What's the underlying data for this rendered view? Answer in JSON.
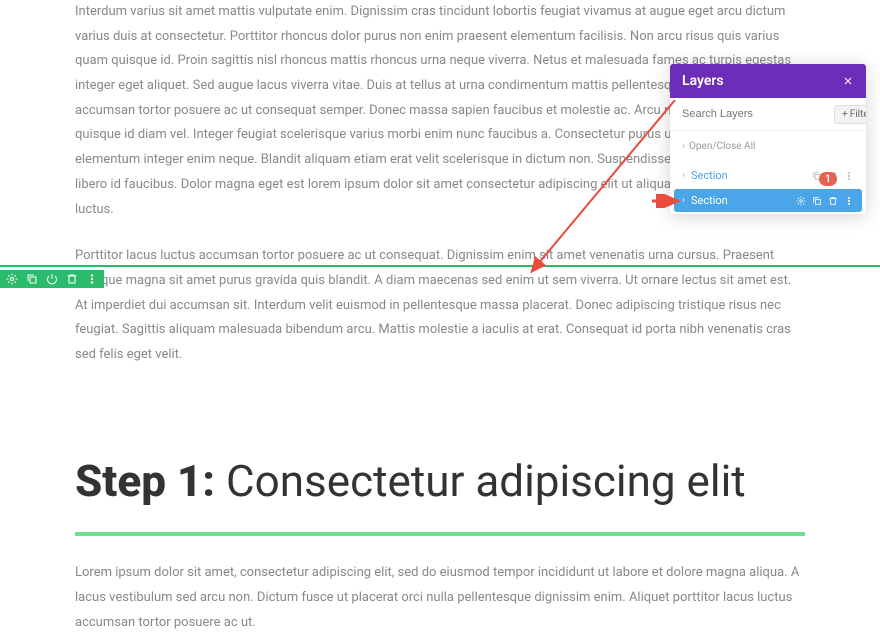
{
  "content": {
    "p1": "Interdum varius sit amet mattis vulputate enim. Dignissim cras tincidunt lobortis feugiat vivamus at augue eget arcu dictum varius duis at consectetur. Porttitor rhoncus dolor purus non enim praesent elementum facilisis. Non arcu risus quis varius quam quisque id. Proin sagittis nisl rhoncus mattis rhoncus urna neque viverra. Netus et malesuada fames ac turpis egestas integer eget aliquet. Sed augue lacus viverra vitae. Duis at tellus at urna condimentum mattis pellentesque id. Luctus accumsan tortor posuere ac ut consequat semper. Donec massa sapien faucibus et molestie ac. Arcu risus quis varius quam quisque id diam vel. Integer feugiat scelerisque varius morbi enim nunc faucibus a. Consectetur purus ut faucibus pulvinar elementum integer enim neque. Blandit aliquam etiam erat velit scelerisque in dictum non. Suspendisse interdum consectetur libero id faucibus. Dolor magna eget est lorem ipsum dolor sit amet consectetur adipiscing elit ut aliquam purus sit amet luctus.",
    "p2": "Porttitor lacus luctus accumsan tortor posuere ac ut consequat. Dignissim enim sit amet venenatis urna cursus. Praesent tristique magna sit amet purus gravida quis blandit. A diam maecenas sed enim ut sem viverra. Ut ornare lectus sit amet est. At imperdiet dui accumsan sit. Interdum velit euismod in pellentesque massa placerat. Donec adipiscing tristique risus nec feugiat. Sagittis aliquam malesuada bibendum arcu. Mattis molestie a iaculis at erat. Consequat id porta nibh venenatis cras sed felis eget velit.",
    "p3": "Lorem ipsum dolor sit amet, consectetur adipiscing elit, sed do eiusmod tempor incididunt ut labore et dolore magna aliqua. A lacus vestibulum sed arcu non. Dictum fusce ut placerat orci nulla pellentesque dignissim enim. Aliquet porttitor lacus luctus accumsan tortor posuere ac ut."
  },
  "heading": {
    "bold": "Step 1:",
    "rest": " Consectetur adipiscing elit"
  },
  "panel": {
    "title": "Layers",
    "search_placeholder": "Search Layers",
    "filter": "Filter",
    "open_close": "Open/Close All",
    "layers": [
      {
        "label": "Section"
      },
      {
        "label": "Section"
      }
    ]
  },
  "badge": "1"
}
